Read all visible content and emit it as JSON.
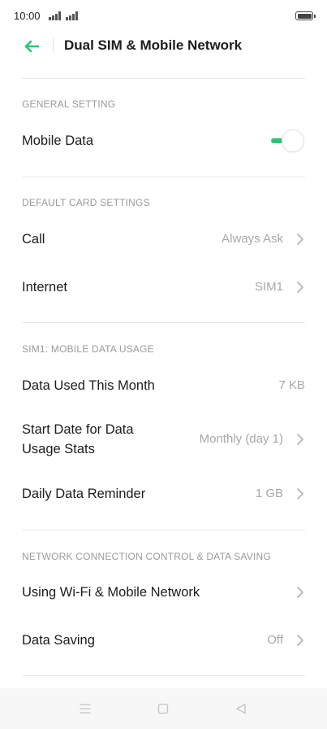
{
  "status_bar": {
    "time": "10:00",
    "icons": [
      "signal-icon",
      "signal-icon",
      "battery-icon"
    ]
  },
  "header": {
    "title": "Dual SIM & Mobile Network",
    "back_icon": "back-arrow-icon",
    "accent_color": "#2bc57a"
  },
  "sections": {
    "general": {
      "title": "GENERAL SETTING",
      "mobile_data": {
        "label": "Mobile Data",
        "toggle_on": true
      }
    },
    "default_card": {
      "title": "DEFAULT CARD SETTINGS",
      "call": {
        "label": "Call",
        "value": "Always Ask"
      },
      "internet": {
        "label": "Internet",
        "value": "SIM1"
      }
    },
    "usage": {
      "title": "SIM1: MOBILE DATA USAGE",
      "data_used": {
        "label": "Data Used This Month",
        "value": "7 KB"
      },
      "start_date": {
        "label_line1": "Start Date for Data",
        "label_line2": "Usage Stats",
        "value": "Monthly (day 1)"
      },
      "daily_reminder": {
        "label": "Daily Data Reminder",
        "value": "1 GB"
      }
    },
    "network_control": {
      "title": "NETWORK CONNECTION CONTROL & DATA SAVING",
      "wifi_mobile": {
        "label": "Using Wi-Fi & Mobile Network"
      },
      "data_saving": {
        "label": "Data Saving",
        "value": "Off"
      }
    }
  },
  "nav_bar": {
    "icons": [
      "menu-icon",
      "home-icon",
      "back-icon"
    ]
  }
}
